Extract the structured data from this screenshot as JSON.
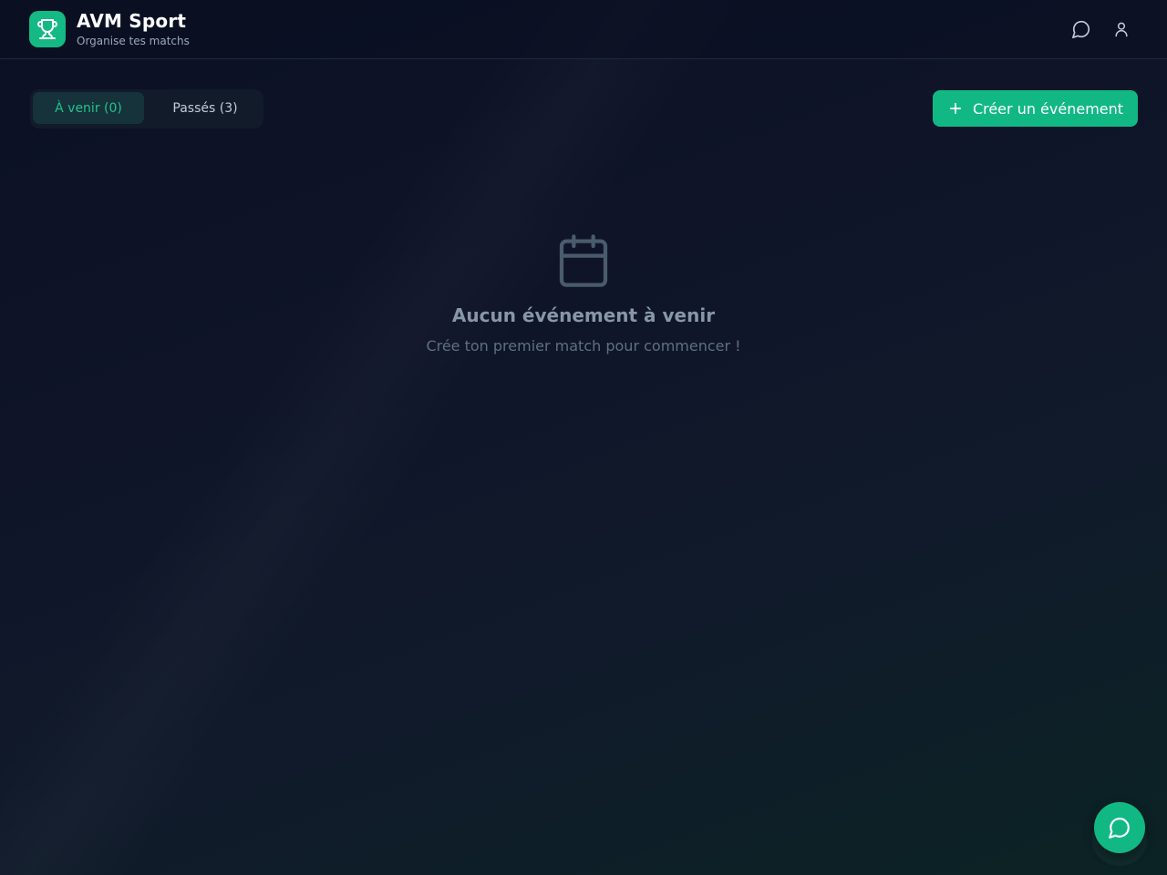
{
  "app": {
    "title": "AVM Sport",
    "subtitle": "Organise tes matchs",
    "logo_icon": "trophy-icon"
  },
  "header": {
    "icons": [
      "message-circle-icon",
      "user-icon"
    ]
  },
  "tabs": [
    {
      "label": "À venir (0)",
      "active": true
    },
    {
      "label": "Passés (3)",
      "active": false
    }
  ],
  "actions": {
    "create_label": "Créer un événement",
    "create_icon": "plus-icon"
  },
  "empty_state": {
    "icon": "calendar-icon",
    "title": "Aucun événement à venir",
    "subtitle": "Crée ton premier match pour commencer !"
  },
  "fab": {
    "icon": "message-circle-icon"
  },
  "colors": {
    "accent": "#12b884",
    "background": "#0f1429",
    "tab_active_text": "#22c38e"
  }
}
